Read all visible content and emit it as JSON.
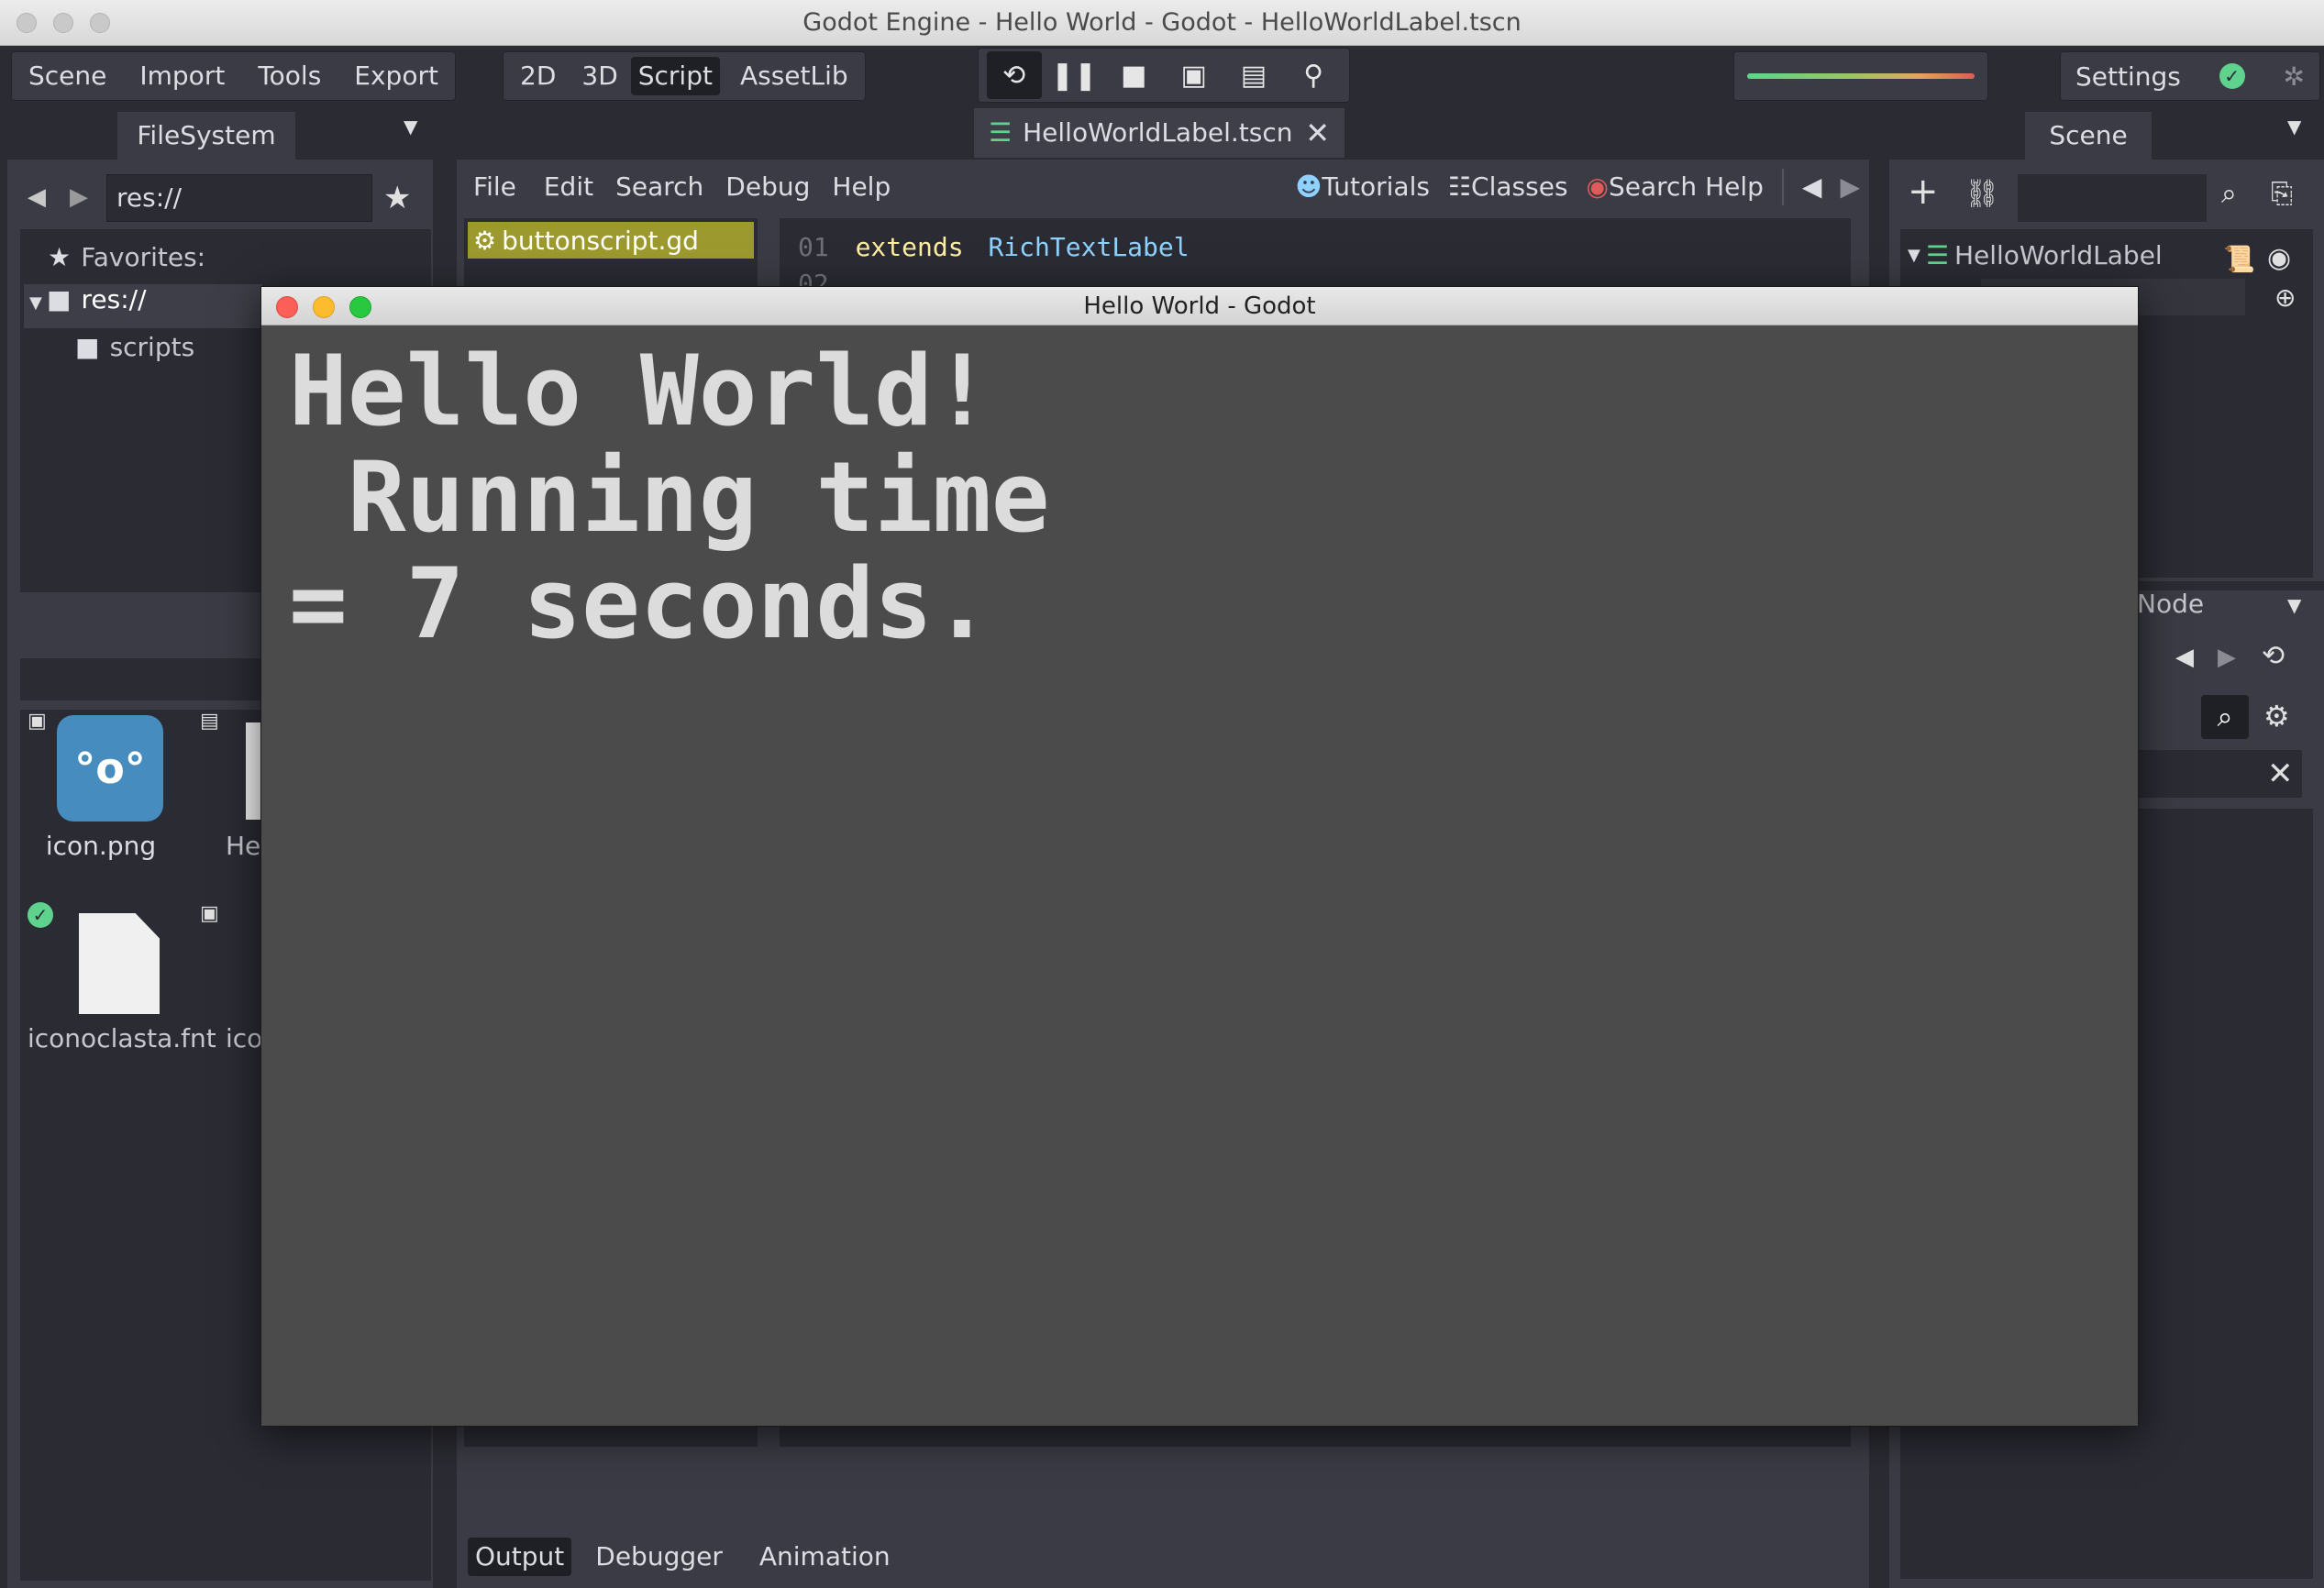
{
  "window_title": "Godot Engine - Hello World - Godot - HelloWorldLabel.tscn",
  "main_menu": [
    "Scene",
    "Import",
    "Tools",
    "Export"
  ],
  "workspace_tabs": [
    "2D",
    "3D",
    "Script",
    "AssetLib"
  ],
  "active_workspace": "Script",
  "settings_label": "Settings",
  "filesystem": {
    "tab_label": "FileSystem",
    "path_value": "res://",
    "favorites_label": "Favorites:",
    "tree_root": "res://",
    "tree_child": "scripts",
    "files": [
      {
        "name": "icon.png"
      },
      {
        "name": "Hello"
      },
      {
        "name": "iconoclasta.fnt"
      },
      {
        "name": "icon"
      }
    ]
  },
  "scene_tab": {
    "label": "HelloWorldLabel.tscn"
  },
  "script_menu": [
    "File",
    "Edit",
    "Search",
    "Debug",
    "Help"
  ],
  "script_help": {
    "tutorials": "Tutorials",
    "classes": "Classes",
    "search_help": "Search Help"
  },
  "script_list": [
    "buttonscript.gd"
  ],
  "code": {
    "line1_num": "01",
    "line1_keyword": "extends",
    "line1_type": "RichTextLabel",
    "line2_num": "02"
  },
  "scene_panel": {
    "tab_label": "Scene",
    "root_node": "HelloWorldLabel"
  },
  "inspector": {
    "tab_label": "Node"
  },
  "bottom_tabs": [
    "Output",
    "Debugger",
    "Animation"
  ],
  "game_window": {
    "title": "Hello World - Godot",
    "text_line1": "Hello World!",
    "text_line2": " Running time",
    "text_line3": "= 7 seconds."
  },
  "colors": {
    "accent_green": "#5fd38d",
    "script_highlight": "#9c9a2e",
    "keyword": "#ffeda1",
    "type": "#8fd1ff",
    "line_number": "#6e6f78"
  }
}
